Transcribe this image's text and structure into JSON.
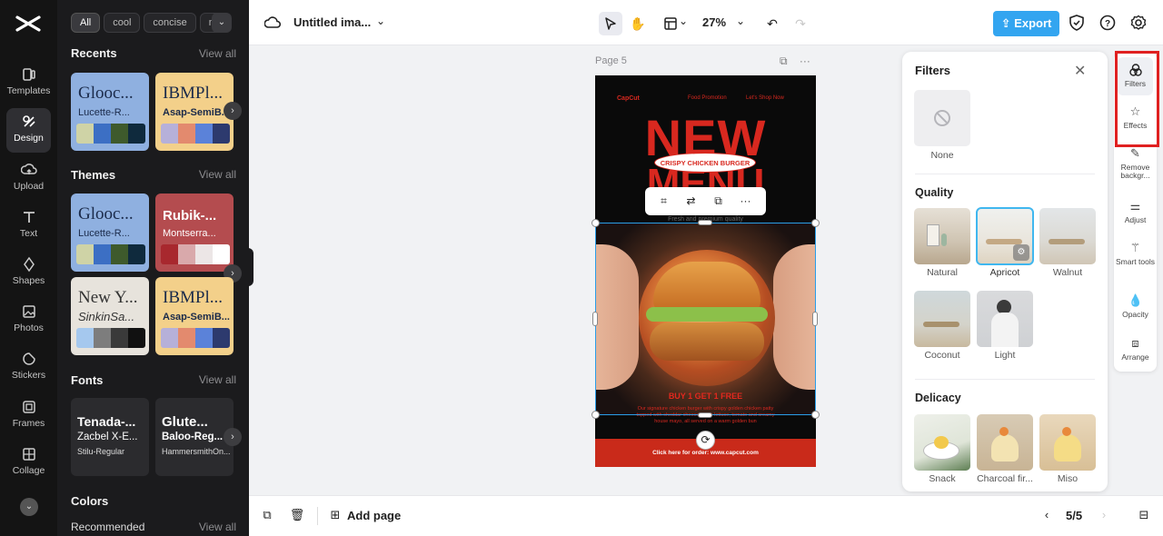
{
  "rail": {
    "items": [
      {
        "label": "Templates"
      },
      {
        "label": "Design"
      },
      {
        "label": "Upload"
      },
      {
        "label": "Text"
      },
      {
        "label": "Shapes"
      },
      {
        "label": "Photos"
      },
      {
        "label": "Stickers"
      },
      {
        "label": "Frames"
      },
      {
        "label": "Collage"
      }
    ],
    "active": "Design"
  },
  "panel": {
    "chips": [
      "All",
      "cool",
      "concise",
      "m"
    ],
    "recents_title": "Recents",
    "themes_title": "Themes",
    "fonts_title": "Fonts",
    "colors_title": "Colors",
    "recommended_label": "Recommended",
    "view_all": "View all",
    "recents": [
      {
        "t1": "Glooc...",
        "t2": "Lucette-R...",
        "bg": "#8fb0e0",
        "fg": "#1a2a4a",
        "swatches": [
          "#cfd3a6",
          "#3c6fc4",
          "#3e5a2c",
          "#0f2a3d"
        ]
      },
      {
        "t1": "IBMPl...",
        "t2": "Asap-SemiB...",
        "bg": "#f3d08a",
        "fg": "#1a2a4a",
        "swatches": [
          "#b6b0d9",
          "#e38a6e",
          "#5b82d9",
          "#2d3a6e"
        ]
      }
    ],
    "themes": [
      {
        "t1": "Glooc...",
        "t2": "Lucette-R...",
        "bg": "#8fb0e0",
        "fg": "#1a2a4a",
        "swatches": [
          "#cfd3a6",
          "#3c6fc4",
          "#3e5a2c",
          "#0f2a3d"
        ]
      },
      {
        "t1": "Rubik-...",
        "t2": "Montserra...",
        "bg": "#b44c4f",
        "fg": "#ffffff",
        "swatches": [
          "#a8282e",
          "#d9a9ab",
          "#ece6e6",
          "#ffffff"
        ]
      },
      {
        "t1": "New Y...",
        "t2": "SinkinSa...",
        "bg": "#e7e3dc",
        "fg": "#333333",
        "swatches": [
          "#a5c8ee",
          "#7d7d7d",
          "#3a3a3a",
          "#111111"
        ]
      },
      {
        "t1": "IBMPl...",
        "t2": "Asap-SemiB...",
        "bg": "#f3d08a",
        "fg": "#1a2a4a",
        "swatches": [
          "#b6b0d9",
          "#e38a6e",
          "#5b82d9",
          "#2d3a6e"
        ]
      }
    ],
    "fonts": [
      {
        "f1": "Tenada-...",
        "f2": "Zacbel X-E...",
        "f3": "Stilu-Regular"
      },
      {
        "f1": "Glute...",
        "f2": "Baloo-Reg...",
        "f3": "HammersmithOn..."
      }
    ]
  },
  "topbar": {
    "doc_title": "Untitled ima...",
    "zoom": "27%",
    "export_label": "Export"
  },
  "canvas": {
    "page_label": "Page 5",
    "poster": {
      "brand": "CapCut",
      "nav1": "Food Promotion",
      "nav2": "Let's Shop Now",
      "headline1": "NEW",
      "headline2": "MENU",
      "pill": "CRISPY CHICKEN BURGER",
      "subline": "Fresh and premium quality",
      "promo": "BUY 1 GET 1 FREE",
      "desc": "Our signature chicken burger with crispy golden chicken patty topped with cheddar cheese, fresh lettuce, tomato and creamy house mayo, all served on a warm golden bun",
      "footer": "Click here for order:  www.capcut.com"
    }
  },
  "filters": {
    "title": "Filters",
    "none_label": "None",
    "quality_title": "Quality",
    "delicacy_title": "Delicacy",
    "quality": [
      {
        "label": "Natural",
        "selected": false
      },
      {
        "label": "Apricot",
        "selected": true
      },
      {
        "label": "Walnut",
        "selected": false
      },
      {
        "label": "Coconut",
        "selected": false
      },
      {
        "label": "Light",
        "selected": false
      }
    ],
    "delicacy": [
      {
        "label": "Snack"
      },
      {
        "label": "Charcoal fir..."
      },
      {
        "label": "Miso"
      }
    ]
  },
  "tools": [
    {
      "label": "Filters",
      "active": true
    },
    {
      "label": "Effects",
      "active": false
    },
    {
      "label": "Remove backgr...",
      "active": false
    },
    {
      "label": "Adjust",
      "active": false
    },
    {
      "label": "Smart tools",
      "active": false
    },
    {
      "label": "Opacity",
      "active": false
    },
    {
      "label": "Arrange",
      "active": false
    }
  ],
  "bottombar": {
    "add_page": "Add page",
    "page_count": "5/5"
  },
  "colors": {
    "accent": "#33a5f0",
    "highlight": "#e02020",
    "selection": "#2a9ee8"
  }
}
